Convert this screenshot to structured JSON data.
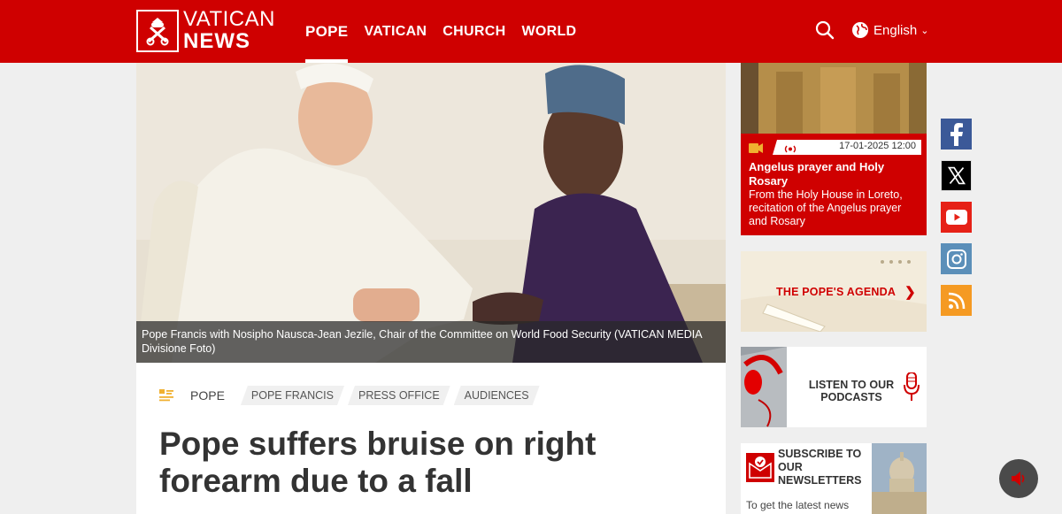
{
  "logo": {
    "line1": "VATICAN",
    "line2": "NEWS"
  },
  "nav": {
    "items": [
      "POPE",
      "VATICAN",
      "CHURCH",
      "WORLD"
    ],
    "active": "POPE"
  },
  "language": {
    "label": "English"
  },
  "hero": {
    "caption": "Pope Francis with Nosipho Nausca-Jean Jezile, Chair of the Committee on World Food Security  (VATICAN MEDIA Divisione Foto)"
  },
  "article": {
    "category": "POPE",
    "tags": [
      "POPE FRANCIS",
      "PRESS OFFICE",
      "AUDIENCES"
    ],
    "headline": "Pope suffers bruise on right forearm due to a fall"
  },
  "live": {
    "datetime": "17-01-2025 12:00",
    "title": "Angelus prayer and Holy Rosary",
    "description": "From the Holy House in Loreto, recitation of the Angelus prayer and Rosary"
  },
  "agenda": {
    "label": "THE POPE'S AGENDA"
  },
  "podcast": {
    "label": "LISTEN TO OUR PODCASTS"
  },
  "newsletter": {
    "label": "SUBSCRIBE TO OUR NEWSLETTERS",
    "sub": "To get the latest news"
  },
  "social": [
    "facebook-icon",
    "x-icon",
    "youtube-icon",
    "instagram-icon",
    "rss-icon"
  ],
  "colors": {
    "brand": "#cf0000",
    "facebook": "#3b5998",
    "youtube": "#e62117",
    "instagram": "#5b8fb9",
    "rss": "#f59a23"
  }
}
